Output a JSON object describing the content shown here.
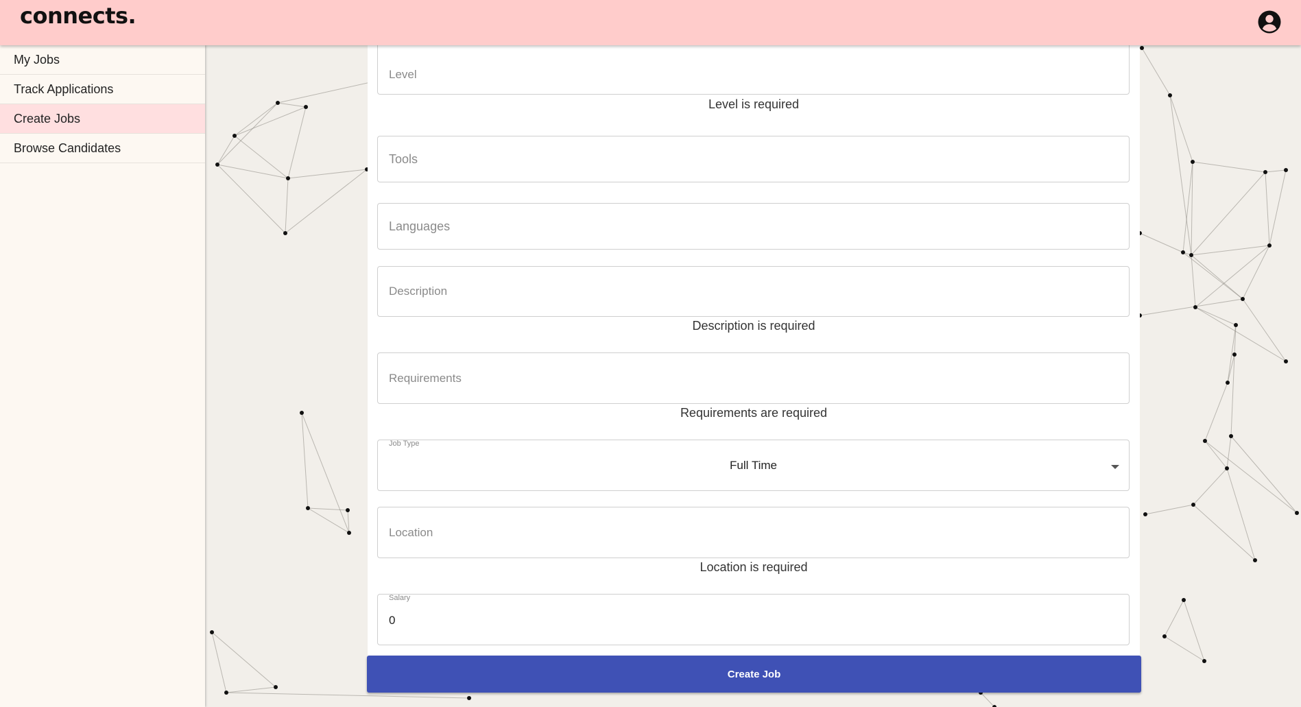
{
  "app": {
    "logo": "connects."
  },
  "header": {
    "profile_icon": "account-circle-icon"
  },
  "sidebar": {
    "items": [
      {
        "label": "My Jobs",
        "active": false
      },
      {
        "label": "Track Applications",
        "active": false
      },
      {
        "label": "Create Jobs",
        "active": true
      },
      {
        "label": "Browse Candidates",
        "active": false
      }
    ]
  },
  "form": {
    "level": {
      "placeholder": "Level",
      "error": "Level is required"
    },
    "tools": {
      "placeholder": "Tools"
    },
    "languages": {
      "placeholder": "Languages"
    },
    "description": {
      "placeholder": "Description",
      "error": "Description is required"
    },
    "requirements": {
      "placeholder": "Requirements",
      "error": "Requirements are required"
    },
    "job_type": {
      "label": "Job Type",
      "value": "Full Time"
    },
    "location": {
      "placeholder": "Location",
      "error": "Location is required"
    },
    "salary": {
      "label": "Salary",
      "value": "0"
    },
    "submit_label": "Create Job"
  },
  "colors": {
    "header_bg": "#ffcccb",
    "sidebar_bg": "#fdf8f2",
    "active_nav": "#ffdfe0",
    "button": "#3f51b5"
  }
}
